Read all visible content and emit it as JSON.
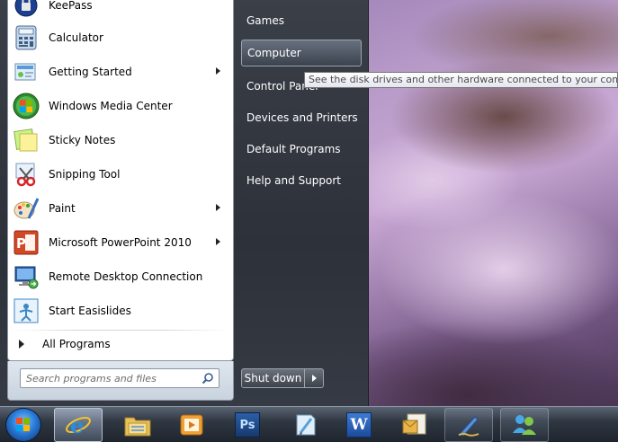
{
  "programs": [
    {
      "label": "KeePass",
      "icon": "keepass-icon",
      "has_submenu": false
    },
    {
      "label": "Calculator",
      "icon": "calculator-icon",
      "has_submenu": false
    },
    {
      "label": "Getting Started",
      "icon": "getting-started-icon",
      "has_submenu": true
    },
    {
      "label": "Windows Media Center",
      "icon": "windows-media-center-icon",
      "has_submenu": false
    },
    {
      "label": "Sticky Notes",
      "icon": "sticky-notes-icon",
      "has_submenu": false
    },
    {
      "label": "Snipping Tool",
      "icon": "snipping-tool-icon",
      "has_submenu": false
    },
    {
      "label": "Paint",
      "icon": "paint-icon",
      "has_submenu": true
    },
    {
      "label": "Microsoft PowerPoint 2010",
      "icon": "powerpoint-icon",
      "has_submenu": true
    },
    {
      "label": "Remote Desktop Connection",
      "icon": "remote-desktop-icon",
      "has_submenu": false
    },
    {
      "label": "Start Easislides",
      "icon": "easislides-icon",
      "has_submenu": false
    }
  ],
  "all_programs": "All Programs",
  "search": {
    "placeholder": "Search programs and files"
  },
  "right_menu": [
    {
      "label": "Games"
    },
    {
      "label": "Computer"
    },
    {
      "label": "Control Panel"
    },
    {
      "label": "Devices and Printers"
    },
    {
      "label": "Default Programs"
    },
    {
      "label": "Help and Support"
    }
  ],
  "tooltip": "See the disk drives and other hardware connected to your computer.",
  "shutdown": {
    "label": "Shut down"
  },
  "taskbar": {
    "items": [
      {
        "icon": "start-orb-icon"
      },
      {
        "icon": "internet-explorer-icon"
      },
      {
        "icon": "windows-explorer-icon"
      },
      {
        "icon": "media-player-icon"
      },
      {
        "icon": "photoshop-icon",
        "label": "Ps"
      },
      {
        "icon": "notepad-icon"
      },
      {
        "icon": "word-icon",
        "label": "W"
      },
      {
        "icon": "outlook-icon"
      },
      {
        "icon": "pen-tool-icon"
      },
      {
        "icon": "messenger-icon"
      }
    ]
  }
}
